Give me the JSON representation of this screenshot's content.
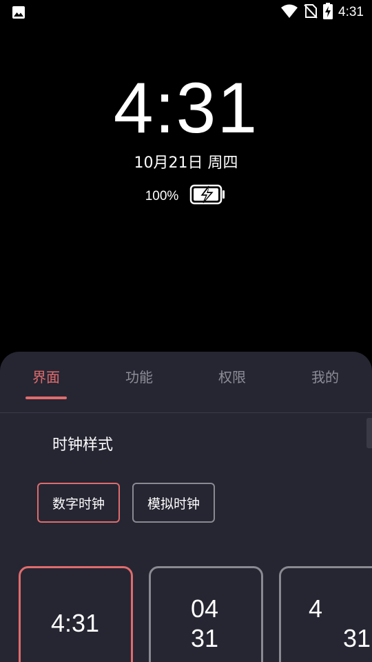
{
  "status_bar": {
    "time": "4:31",
    "icons": [
      "image-icon",
      "wifi-icon",
      "no-sim-icon",
      "battery-charging-icon"
    ]
  },
  "clock": {
    "time": "4:31",
    "date": "10月21日 周四",
    "battery_percent": "100%",
    "battery_level": 1.0
  },
  "tabs": [
    {
      "label": "界面",
      "active": true
    },
    {
      "label": "功能",
      "active": false
    },
    {
      "label": "权限",
      "active": false
    },
    {
      "label": "我的",
      "active": false
    }
  ],
  "section": {
    "title": "时钟样式",
    "buttons": [
      {
        "label": "数字时钟",
        "selected": true
      },
      {
        "label": "模拟时钟",
        "selected": false
      }
    ]
  },
  "previews": [
    {
      "text": "4:31",
      "selected": true
    },
    {
      "hour": "04",
      "minute": "31",
      "selected": false
    },
    {
      "hour": "4",
      "minute": "31",
      "selected": false
    }
  ],
  "colors": {
    "accent": "#e06c6c",
    "panel": "#262633",
    "background": "#000000",
    "inactive_tab": "#8d8d97"
  }
}
